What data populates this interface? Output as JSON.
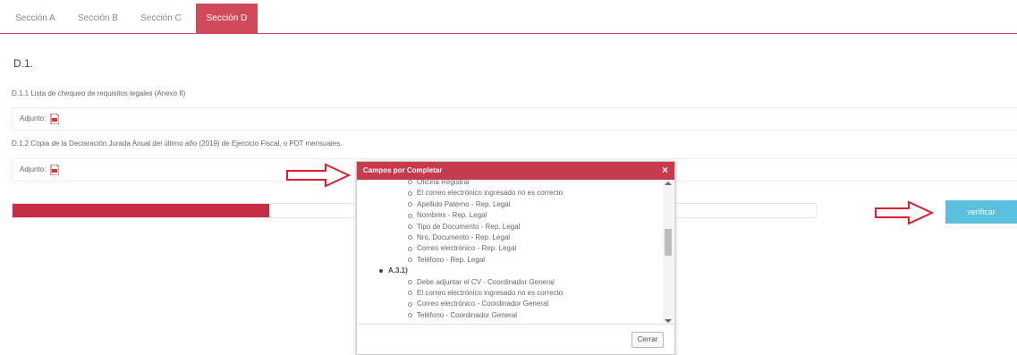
{
  "tabs": [
    {
      "label": "Sección A",
      "active": false
    },
    {
      "label": "Sección B",
      "active": false
    },
    {
      "label": "Sección C",
      "active": false
    },
    {
      "label": "Sección D",
      "active": true
    }
  ],
  "section_heading": "D.1.",
  "requirements": [
    {
      "label": "D.1.1 Lista de chequeo de requisitos legales (Anexo II)",
      "attach_label": "Adjunto:",
      "icon": "pdf-icon"
    },
    {
      "label": "D.1.2 Copia de la Declaración Jurada Anual del último año (2019) de Ejercicio Fiscal, o PDT mensuales.",
      "attach_label": "Adjunto:",
      "icon": "pdf-icon"
    }
  ],
  "progress": {
    "fraction": 0.32,
    "color": "#c42d44"
  },
  "verify_button": {
    "label": "verificar",
    "color": "#5bc0de"
  },
  "modal": {
    "title": "Campos por Completar",
    "close_symbol": "×",
    "close_button": "Cerrar",
    "header_color": "#c73a4c",
    "items": [
      {
        "text": "Oficina Registral",
        "level": 2
      },
      {
        "text": "El correo electrónico ingresado no es correcto",
        "level": 2
      },
      {
        "text": "Apellido Paterno - Rep. Legal",
        "level": 2
      },
      {
        "text": "Nombres - Rep. Legal",
        "level": 2
      },
      {
        "text": "Tipo de Documento - Rep. Legal",
        "level": 2
      },
      {
        "text": "Nro. Documento - Rep. Legal",
        "level": 2
      },
      {
        "text": "Correo electrónico - Rep. Legal",
        "level": 2
      },
      {
        "text": "Teléfono - Rep. Legal",
        "level": 2
      },
      {
        "text": "A.3.1)",
        "level": 1
      },
      {
        "text": "Debe adjuntar el CV - Coordinador General",
        "level": 2
      },
      {
        "text": "El correo electrónico ingresado no es correcto",
        "level": 2
      },
      {
        "text": "Correo electrónico - Coordinador General",
        "level": 2
      },
      {
        "text": "Teléfono - Coordinador General",
        "level": 2
      }
    ]
  },
  "annotation_color": "#e0202e"
}
